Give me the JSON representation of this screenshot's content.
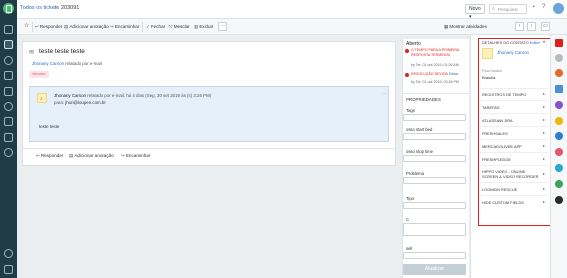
{
  "breadcrumb": {
    "parent": "Todos os tickets",
    "separator": ">",
    "current": "203091"
  },
  "header": {
    "new_label": "Novo",
    "search_placeholder": "Pesquisar"
  },
  "toolbar": {
    "reply": "Responder",
    "add_note": "Adicionar anotação",
    "forward": "Encaminhar",
    "close": "Fechar",
    "merge": "Mesclar",
    "delete": "Excluir",
    "show_activities": "Mostrar atividades"
  },
  "ticket": {
    "subject": "teste teste teste",
    "requester": "Jhonany Carson",
    "reported_via": "relatado por e-mail",
    "badge": "Vencido",
    "message": {
      "author": "Jhonany Carson",
      "meta": "relatado por e-mail, há 4 dias (Seg, 30 set 2019 às (s) 3:26 PM)",
      "to_label": "para:",
      "to_address": "jhon@loupen.com.br",
      "body": "teste teste"
    },
    "footer": {
      "reply": "Responder",
      "add_note": "Adicionar anotação",
      "forward": "Encaminhar"
    }
  },
  "status": {
    "state": "Aberto",
    "first_response": {
      "title": "O TEMPO PARA A PRIMEIRA RESPOSTA TERMINOU",
      "detail": "by Ter, 01 out 2019, 01:26 AM"
    },
    "resolution": {
      "title": "RESOLUÇÃO DEVIDA",
      "edit": "Editar",
      "detail": "by Ter, 01 out 2019, 03:26 PM"
    }
  },
  "properties": {
    "title": "PROPRIEDADES",
    "fields": [
      "Tags",
      "osso start bed",
      "osso stop time",
      "Problema",
      "Tipo",
      "C",
      "sell"
    ],
    "update_button": "Atualizar"
  },
  "contact": {
    "section_title": "DETALHES DO CONTATO",
    "edit": "Editar",
    "name": "Jhonany Carson",
    "timezone_label": "Fuso horário",
    "timezone_value": "Brasília"
  },
  "sections": [
    "REGISTROS DE TEMPO",
    "TAREFAS",
    "ATLASSIAN JIRA",
    "FRESHSALES",
    "MERCADOLIVRE APP",
    "FRESHPLEDGE",
    "HIPPO VIDEO - ONLINE SCREEN & VIDEO RECORDER",
    "LOGMEIN RESCUE",
    "HIDE CUSTOM FIELDS"
  ],
  "colors": {
    "nav": "#213c47",
    "accent": "#2d6ec9",
    "overdue": "#e05a6b",
    "highlight": "#e0201b",
    "message_bg": "#e6f0fa"
  }
}
